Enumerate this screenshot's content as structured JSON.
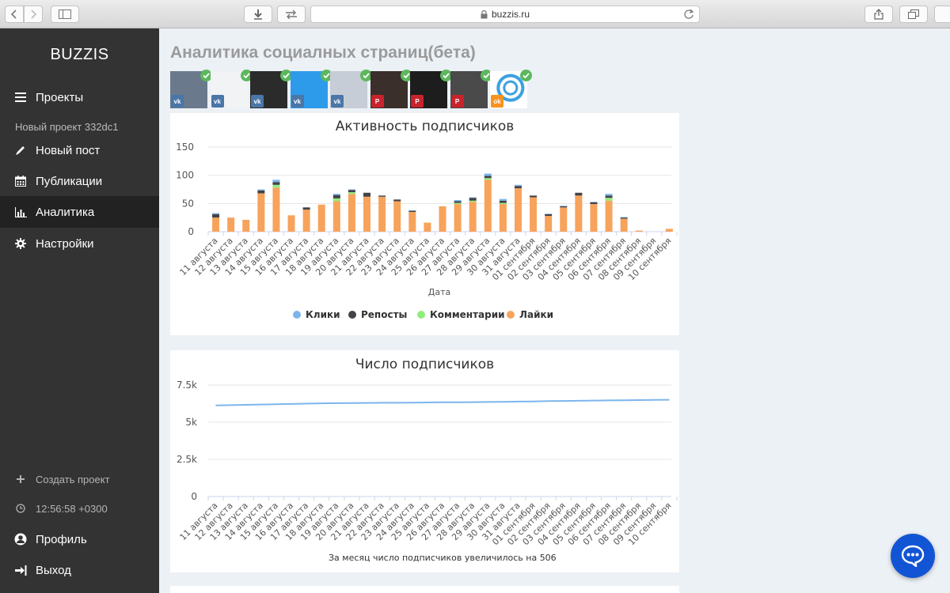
{
  "browser": {
    "url": "buzzis.ru"
  },
  "sidebar": {
    "brand": "BUZZIS",
    "projects_label": "Проекты",
    "current_project": "Новый проект 332dc1",
    "items": [
      {
        "label": "Новый пост",
        "icon": "pencil-icon"
      },
      {
        "label": "Публикации",
        "icon": "calendar-icon"
      },
      {
        "label": "Аналитика",
        "icon": "bar-chart-icon",
        "active": true
      },
      {
        "label": "Настройки",
        "icon": "gear-icon"
      }
    ],
    "create_project": "Создать проект",
    "time": "12:56:58 +0300",
    "profile": "Профиль",
    "logout": "Выход"
  },
  "main": {
    "title": "Аналитика социалных страниц(бета)",
    "pages": [
      {
        "network": "vk",
        "color": "#4a76a8",
        "thumb": "#6a7a8c"
      },
      {
        "network": "vk",
        "color": "#4a76a8",
        "thumb": "#f1f3f5"
      },
      {
        "network": "vk",
        "color": "#4a76a8",
        "thumb": "#2b2b2b"
      },
      {
        "network": "vk",
        "color": "#4a76a8",
        "thumb": "#2e9bea"
      },
      {
        "network": "vk",
        "color": "#4a76a8",
        "thumb": "#c7cdd6"
      },
      {
        "network": "pinterest",
        "color": "#c8232c",
        "thumb": "#3a2f2a"
      },
      {
        "network": "pinterest",
        "color": "#c8232c",
        "thumb": "#1d1d1d"
      },
      {
        "network": "pinterest",
        "color": "#c8232c",
        "thumb": "#4a4a4a"
      },
      {
        "network": "ok",
        "color": "#f7931e",
        "thumb": "#ffffff"
      }
    ]
  },
  "colors": {
    "clicks": "#7cb5ec",
    "reposts": "#434348",
    "comments": "#90ed7d",
    "likes": "#f7a35c",
    "line": "#7cb5ec"
  },
  "chart_data": [
    {
      "type": "bar",
      "title": "Активность подписчиков",
      "xlabel": "Дата",
      "ylabel": "",
      "ylim": [
        0,
        150
      ],
      "yticks": [
        "0",
        "50",
        "100",
        "150"
      ],
      "stacked": true,
      "legend_position": "bottom",
      "categories": [
        "11 августа",
        "12 августа",
        "13 августа",
        "14 августа",
        "15 августа",
        "16 августа",
        "17 августа",
        "18 августа",
        "19 августа",
        "20 августа",
        "21 августа",
        "22 августа",
        "23 августа",
        "24 августа",
        "25 августа",
        "26 августа",
        "27 августа",
        "28 августа",
        "29 августа",
        "30 августа",
        "31 августа",
        "01 сентября",
        "02 сентября",
        "03 сентября",
        "04 сентября",
        "05 сентября",
        "06 сентября",
        "07 сентября",
        "08 сентября",
        "09 сентября",
        "10 сентября"
      ],
      "series": [
        {
          "name": "Лайки",
          "values": [
            25,
            25,
            21,
            68,
            78,
            29,
            39,
            48,
            54,
            67,
            62,
            62,
            54,
            35,
            16,
            45,
            49,
            53,
            92,
            49,
            77,
            61,
            28,
            43,
            64,
            49,
            55,
            23,
            2,
            0,
            5
          ]
        },
        {
          "name": "Комментарии",
          "values": [
            0,
            0,
            0,
            0,
            5,
            0,
            0,
            0,
            5,
            3,
            0,
            0,
            0,
            0,
            0,
            0,
            2,
            2,
            3,
            2,
            0,
            0,
            0,
            0,
            0,
            0,
            5,
            0,
            0,
            0,
            0
          ]
        },
        {
          "name": "Репосты",
          "values": [
            6,
            0,
            0,
            5,
            5,
            0,
            4,
            0,
            6,
            4,
            7,
            2,
            3,
            2,
            0,
            0,
            3,
            5,
            4,
            4,
            4,
            3,
            3,
            2,
            5,
            3,
            4,
            2,
            0,
            0,
            0
          ]
        },
        {
          "name": "Клики",
          "values": [
            2,
            0,
            0,
            2,
            4,
            0,
            0,
            0,
            2,
            1,
            0,
            0,
            0,
            1,
            0,
            0,
            2,
            1,
            4,
            3,
            2,
            0,
            1,
            1,
            0,
            1,
            3,
            1,
            0,
            0,
            0
          ]
        }
      ],
      "legend_order": [
        "Клики",
        "Репосты",
        "Комментарии",
        "Лайки"
      ]
    },
    {
      "type": "line",
      "title": "Число подписчиков",
      "ylim": [
        0,
        7500
      ],
      "yticks": [
        "0",
        "2.5k",
        "5k",
        "7.5k"
      ],
      "grid": true,
      "categories": [
        "11 августа",
        "12 августа",
        "13 августа",
        "14 августа",
        "15 августа",
        "16 августа",
        "17 августа",
        "18 августа",
        "19 августа",
        "20 августа",
        "21 августа",
        "22 августа",
        "23 августа",
        "24 августа",
        "25 августа",
        "26 августа",
        "27 августа",
        "28 августа",
        "29 августа",
        "30 августа",
        "31 августа",
        "01 сентября",
        "02 сентября",
        "03 сентября",
        "04 сентября",
        "05 сентября",
        "06 сентября",
        "07 сентября",
        "08 сентября",
        "09 сентября",
        "10 сентября"
      ],
      "values": [
        6130,
        6150,
        6170,
        6190,
        6210,
        6230,
        6250,
        6270,
        6280,
        6290,
        6300,
        6310,
        6310,
        6320,
        6330,
        6340,
        6340,
        6350,
        6360,
        6370,
        6390,
        6400,
        6420,
        6430,
        6440,
        6460,
        6470,
        6480,
        6490,
        6500,
        6510
      ],
      "note_prefix": "За месяц число подписчиков увеличилось на",
      "note_value": "506"
    }
  ]
}
